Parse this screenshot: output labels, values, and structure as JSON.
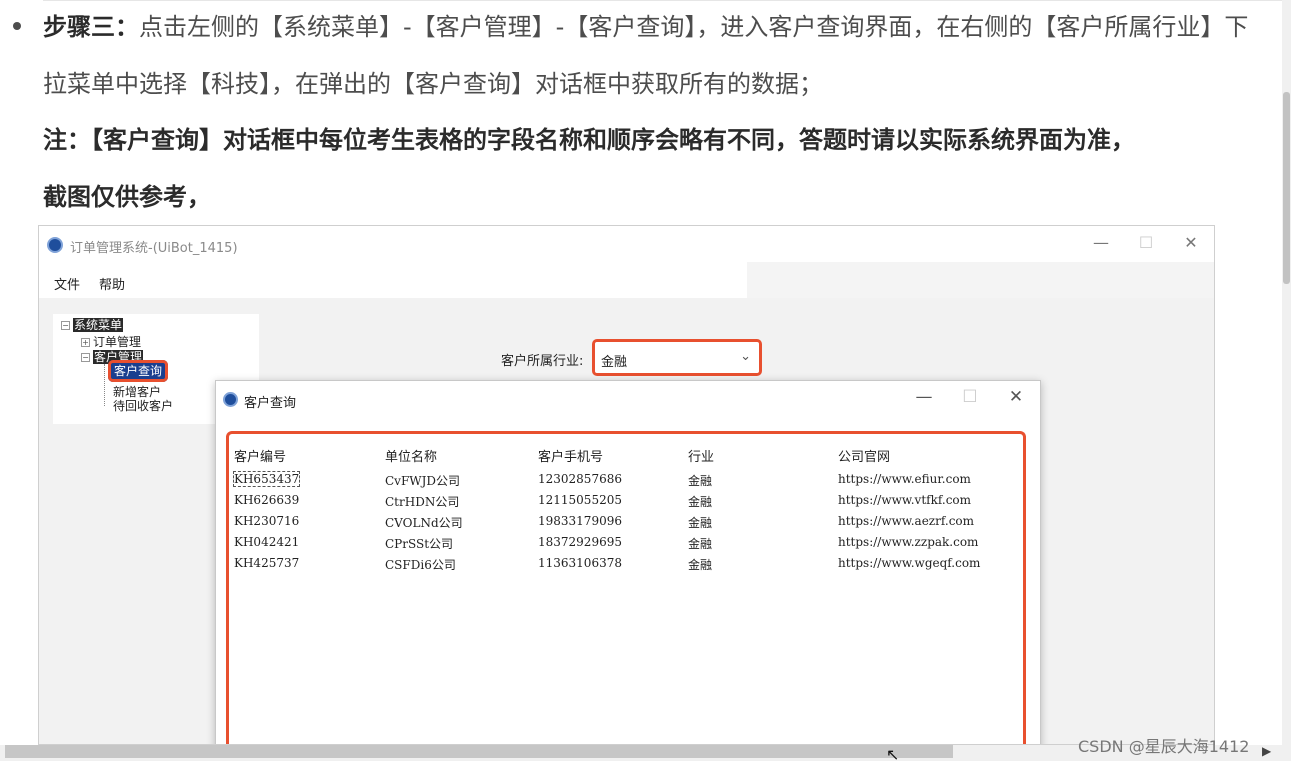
{
  "article": {
    "line1_bold": "步骤三：",
    "line1_rest": "点击左侧的【系统菜单】-【客户管理】-【客户查询】，进入客户查询界面，在右侧的【客户所属行业】下",
    "line2": "拉菜单中选择【科技】，在弹出的【客户查询】对话框中获取所有的数据；",
    "line3": "注：【客户查询】对话框中每位考生表格的字段名称和顺序会略有不同，答题时请以实际系统界面为准，",
    "line4": "截图仅供参考，"
  },
  "app": {
    "title": "订单管理系统-(UiBot_1415)",
    "minimize": "—",
    "maximize": "☐",
    "close": "✕",
    "menu": [
      "文件",
      "帮助"
    ],
    "tree": {
      "root": "系统菜单",
      "order_mgmt": "订单管理",
      "customer_mgmt": "客户管理",
      "customer_query": "客户查询",
      "new_customer": "新增客户",
      "pending_customer": "待回收客户"
    },
    "filter": {
      "label": "客户所属行业:",
      "value": "金融",
      "chevron": "⌄"
    }
  },
  "dialog": {
    "title": "客户查询",
    "minimize": "—",
    "maximize": "☐",
    "close": "✕",
    "columns": [
      "客户编号",
      "单位名称",
      "客户手机号",
      "行业",
      "公司官网"
    ],
    "rows": [
      [
        "KH653437",
        "CvFWJD公司",
        "12302857686",
        "金融",
        "https://www.efiur.com"
      ],
      [
        "KH626639",
        "CtrHDN公司",
        "12115055205",
        "金融",
        "https://www.vtfkf.com"
      ],
      [
        "KH230716",
        "CVOLNd公司",
        "19833179096",
        "金融",
        "https://www.aezrf.com"
      ],
      [
        "KH042421",
        "CPrSSt公司",
        "18372929695",
        "金融",
        "https://www.zzpak.com"
      ],
      [
        "KH425737",
        "CSFDi6公司",
        "11363106378",
        "金融",
        "https://www.wgeqf.com"
      ]
    ]
  },
  "watermark": "CSDN @星辰大海1412",
  "scroll_right_arrow": "▶",
  "cursor_glyph": "↖"
}
